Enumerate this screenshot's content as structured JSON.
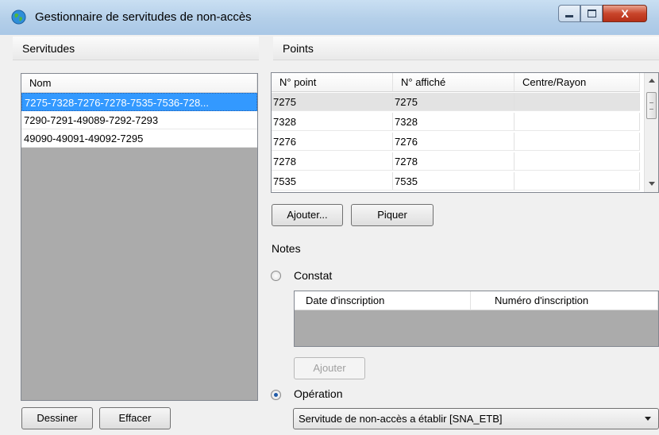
{
  "window": {
    "title": "Gestionnaire de servitudes de non-accès",
    "controls": {
      "close": "X"
    }
  },
  "left": {
    "header": "Servitudes",
    "column": "Nom",
    "items": [
      "7275-7328-7276-7278-7535-7536-728...",
      "7290-7291-49089-7292-7293",
      "49090-49091-49092-7295"
    ],
    "buttons": {
      "draw": "Dessiner",
      "clear": "Effacer"
    }
  },
  "right": {
    "header": "Points",
    "columns": [
      "N° point",
      "N° affiché",
      "Centre/Rayon"
    ],
    "rows": [
      [
        "7275",
        "7275",
        ""
      ],
      [
        "7328",
        "7328",
        ""
      ],
      [
        "7276",
        "7276",
        ""
      ],
      [
        "7278",
        "7278",
        ""
      ],
      [
        "7535",
        "7535",
        ""
      ]
    ],
    "buttons": {
      "add": "Ajouter...",
      "pick": "Piquer"
    },
    "notes_label": "Notes",
    "constat": {
      "label": "Constat",
      "columns": [
        "Date d'inscription",
        "Numéro d'inscription"
      ],
      "add_button": "Ajouter"
    },
    "operation": {
      "label": "Opération",
      "selected": "Servitude de non-accès a établir [SNA_ETB]"
    }
  },
  "colors": {
    "selection": "#3399ff",
    "empty_area": "#ababab"
  }
}
